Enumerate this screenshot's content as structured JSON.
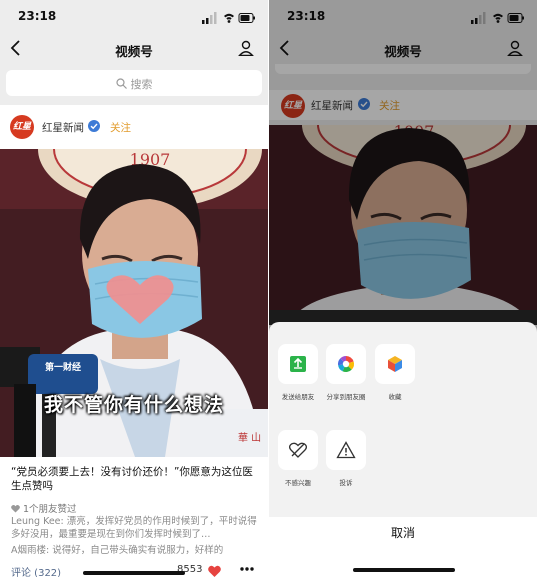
{
  "status_bar": {
    "time": "23:18"
  },
  "nav": {
    "title": "视频号"
  },
  "search": {
    "placeholder": "搜索"
  },
  "account": {
    "avatar_text": "红星",
    "name": "红星新闻",
    "follow_label": "关注"
  },
  "video": {
    "subtitle": "我不管你有什么想法",
    "mic_brand": "第一财经"
  },
  "post": {
    "caption": "“党员必须要上去！没有讨价还价！”你愿意为这位医生点赞吗",
    "friend_likes": "1个朋友赞过",
    "comments": [
      {
        "text": "Leung Kee: 漂亮，发挥好党员的作用时候到了，平时说得多好没用，最重要是现在到你们发挥时候到了…"
      },
      {
        "text": "A烟雨楼: 说得好，自己带头确实有说服力，好样的"
      }
    ],
    "comments_link": "评论 (322)",
    "like_count": "8553"
  },
  "share_sheet": {
    "actions": [
      {
        "label": "发送给朋友",
        "icon": "share-to-friend-icon"
      },
      {
        "label": "分享到朋友圈",
        "icon": "moments-icon"
      },
      {
        "label": "收藏",
        "icon": "favorite-icon"
      },
      {
        "label": "不感兴趣",
        "icon": "not-interested-icon"
      },
      {
        "label": "投诉",
        "icon": "report-icon"
      }
    ],
    "cancel_label": "取消"
  },
  "colors": {
    "follow": "#e29c2d",
    "verified": "#3d7bd6",
    "like_heart": "#e64340",
    "link": "#556a8c",
    "sheet_bg": "#f2f2f2"
  }
}
